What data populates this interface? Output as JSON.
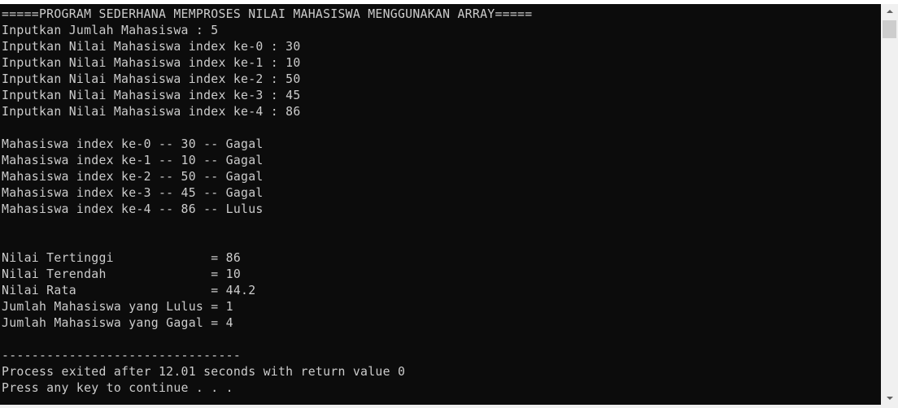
{
  "console": {
    "lines": [
      "=====PROGRAM SEDERHANA MEMPROSES NILAI MAHASISWA MENGGUNAKAN ARRAY=====",
      "Inputkan Jumlah Mahasiswa : 5",
      "Inputkan Nilai Mahasiswa index ke-0 : 30",
      "Inputkan Nilai Mahasiswa index ke-1 : 10",
      "Inputkan Nilai Mahasiswa index ke-2 : 50",
      "Inputkan Nilai Mahasiswa index ke-3 : 45",
      "Inputkan Nilai Mahasiswa index ke-4 : 86",
      "",
      "Mahasiswa index ke-0 -- 30 -- Gagal",
      "Mahasiswa index ke-1 -- 10 -- Gagal",
      "Mahasiswa index ke-2 -- 50 -- Gagal",
      "Mahasiswa index ke-3 -- 45 -- Gagal",
      "Mahasiswa index ke-4 -- 86 -- Lulus",
      "",
      "",
      "Nilai Tertinggi             = 86",
      "Nilai Terendah              = 10",
      "Nilai Rata                  = 44.2",
      "Jumlah Mahasiswa yang Lulus = 1",
      "Jumlah Mahasiswa yang Gagal = 4",
      "",
      "--------------------------------",
      "Process exited after 12.01 seconds with return value 0",
      "Press any key to continue . . ."
    ]
  },
  "scrollbar": {
    "up_icon": "arrow-up-icon",
    "down_icon": "arrow-down-icon"
  },
  "colors": {
    "console_background": "#0c0c0c",
    "console_text": "#cccccc",
    "scrollbar_track": "#f0f0f0",
    "scrollbar_thumb": "#cdcdcd"
  }
}
